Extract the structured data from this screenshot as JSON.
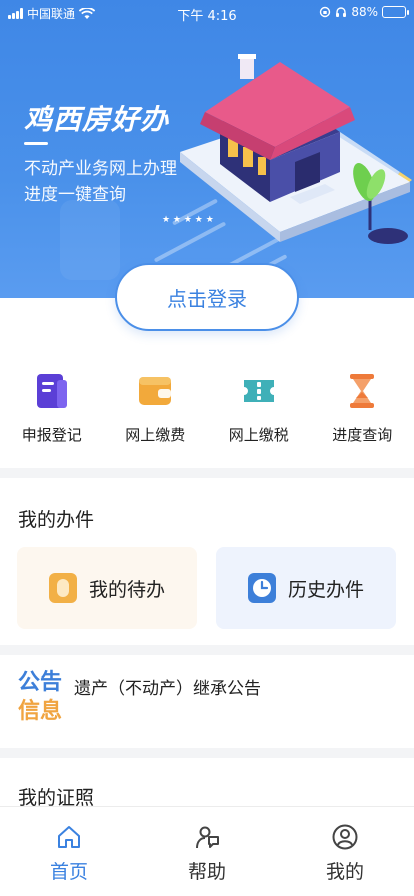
{
  "status_bar": {
    "carrier": "中国联通",
    "time": "下午 4:16",
    "battery_percent": "88%"
  },
  "hero": {
    "title": "鸡西房好办",
    "subtitle_line1": "不动产业务网上办理",
    "subtitle_line2": "进度一键查询",
    "login_label": "点击登录"
  },
  "services": [
    {
      "label": "申报登记",
      "icon": "document-icon",
      "color": "#5b3fd6"
    },
    {
      "label": "网上缴费",
      "icon": "wallet-icon",
      "color": "#f2a93b"
    },
    {
      "label": "网上缴税",
      "icon": "ticket-icon",
      "color": "#3fb0b8"
    },
    {
      "label": "进度查询",
      "icon": "hourglass-icon",
      "color": "#ee7a3a"
    }
  ],
  "my_cases": {
    "title": "我的办件",
    "todo_label": "我的待办",
    "history_label": "历史办件"
  },
  "notice": {
    "tag_line1": "公告",
    "tag_line2": "信息",
    "text": "遗产（不动产）继承公告"
  },
  "licenses": {
    "title": "我的证照"
  },
  "tabbar": [
    {
      "label": "首页",
      "icon": "home-icon",
      "active": true
    },
    {
      "label": "帮助",
      "icon": "help-icon",
      "active": false
    },
    {
      "label": "我的",
      "icon": "profile-icon",
      "active": false
    }
  ],
  "colors": {
    "primary": "#3b82e0",
    "hero_bg": "#4a91ea",
    "accent_orange": "#f0a441"
  }
}
